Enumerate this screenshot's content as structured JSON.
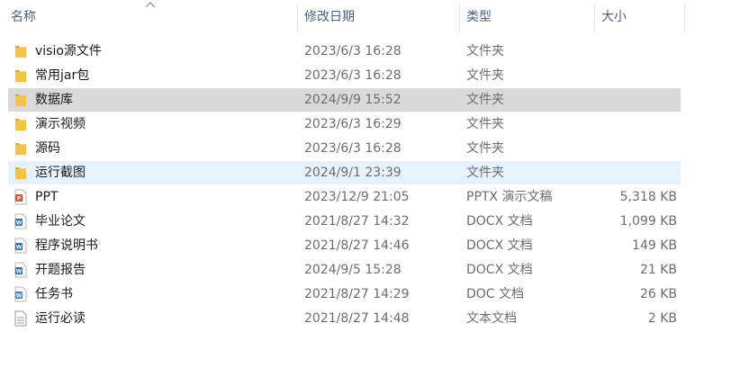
{
  "columns": {
    "name": "名称",
    "date": "修改日期",
    "type": "类型",
    "size": "大小"
  },
  "sort_indicator": "sort-ascending-icon",
  "colors": {
    "folder": "#f5c542",
    "folder_dark": "#e3a919",
    "word_blue": "#2b6cc4",
    "ppt_orange": "#d8572b",
    "selected_bg": "#d9d9d9",
    "hover_bg": "#e5f3ff"
  },
  "files": [
    {
      "name": "visio源文件",
      "date": "2023/6/3 16:28",
      "type": "文件夹",
      "size": "",
      "icon": "folder-icon",
      "state": ""
    },
    {
      "name": "常用jar包",
      "date": "2023/6/3 16:28",
      "type": "文件夹",
      "size": "",
      "icon": "folder-icon",
      "state": ""
    },
    {
      "name": "数据库",
      "date": "2024/9/9 15:52",
      "type": "文件夹",
      "size": "",
      "icon": "folder-icon",
      "state": "selected"
    },
    {
      "name": "演示视频",
      "date": "2023/6/3 16:29",
      "type": "文件夹",
      "size": "",
      "icon": "folder-icon",
      "state": ""
    },
    {
      "name": "源码",
      "date": "2023/6/3 16:28",
      "type": "文件夹",
      "size": "",
      "icon": "folder-icon",
      "state": ""
    },
    {
      "name": "运行截图",
      "date": "2024/9/1 23:39",
      "type": "文件夹",
      "size": "",
      "icon": "folder-icon",
      "state": "hover"
    },
    {
      "name": "PPT",
      "date": "2023/12/9 21:05",
      "type": "PPTX 演示文稿",
      "size": "5,318 KB",
      "icon": "powerpoint-file-icon",
      "state": ""
    },
    {
      "name": "毕业论文",
      "date": "2021/8/27 14:32",
      "type": "DOCX 文档",
      "size": "1,099 KB",
      "icon": "word-file-icon",
      "state": ""
    },
    {
      "name": "程序说明书",
      "date": "2021/8/27 14:46",
      "type": "DOCX 文档",
      "size": "149 KB",
      "icon": "word-file-icon",
      "state": ""
    },
    {
      "name": "开题报告",
      "date": "2024/9/5 15:28",
      "type": "DOCX 文档",
      "size": "21 KB",
      "icon": "word-file-icon",
      "state": ""
    },
    {
      "name": "任务书",
      "date": "2021/8/27 14:29",
      "type": "DOC 文档",
      "size": "26 KB",
      "icon": "word-doc-file-icon",
      "state": ""
    },
    {
      "name": "运行必读",
      "date": "2021/8/27 14:48",
      "type": "文本文档",
      "size": "2 KB",
      "icon": "text-file-icon",
      "state": ""
    }
  ]
}
